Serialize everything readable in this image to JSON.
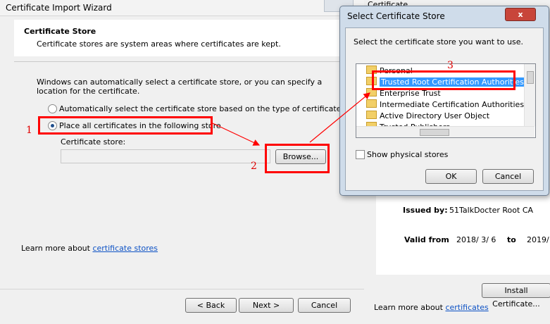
{
  "wizard": {
    "title": "Certificate Import Wizard",
    "section_title": "Certificate Store",
    "section_desc": "Certificate stores are system areas where certificates are kept.",
    "intro": "Windows can automatically select a certificate store, or you can specify a location for the certificate.",
    "radio_auto": "Automatically select the certificate store based on the type of certificate",
    "radio_manual": "Place all certificates in the following store",
    "store_label": "Certificate store:",
    "store_value": "",
    "browse": "Browse...",
    "learn_prefix": "Learn more about ",
    "learn_link": "certificate stores",
    "back": "< Back",
    "next": "Next >",
    "cancel": "Cancel"
  },
  "cert": {
    "title": "Certificate",
    "issued_by_label": "Issued by:",
    "issued_by_value": "51TalkDocter Root CA",
    "valid_from_label": "Valid from",
    "valid_from_value": "2018/ 3/ 6",
    "to_label": "to",
    "to_value": "2019/",
    "install_button": "Install Certificate...",
    "learn_prefix": "Learn more about ",
    "learn_link": "certificates"
  },
  "select_dialog": {
    "title": "Select Certificate Store",
    "prompt": "Select the certificate store you want to use.",
    "stores": [
      "Personal",
      "Trusted Root Certification Authorities",
      "Enterprise Trust",
      "Intermediate Certification Authorities",
      "Active Directory User Object",
      "Trusted Publishers"
    ],
    "selected_store": "Trusted Root Certification Authorities",
    "show_physical": "Show physical stores",
    "ok": "OK",
    "cancel": "Cancel",
    "close_glyph": "x"
  },
  "annotations": {
    "n1": "1",
    "n2": "2",
    "n3": "3"
  },
  "colors": {
    "annotation_red": "#ff0000",
    "selection_blue": "#3399ff",
    "link_blue": "#0d52c5"
  }
}
